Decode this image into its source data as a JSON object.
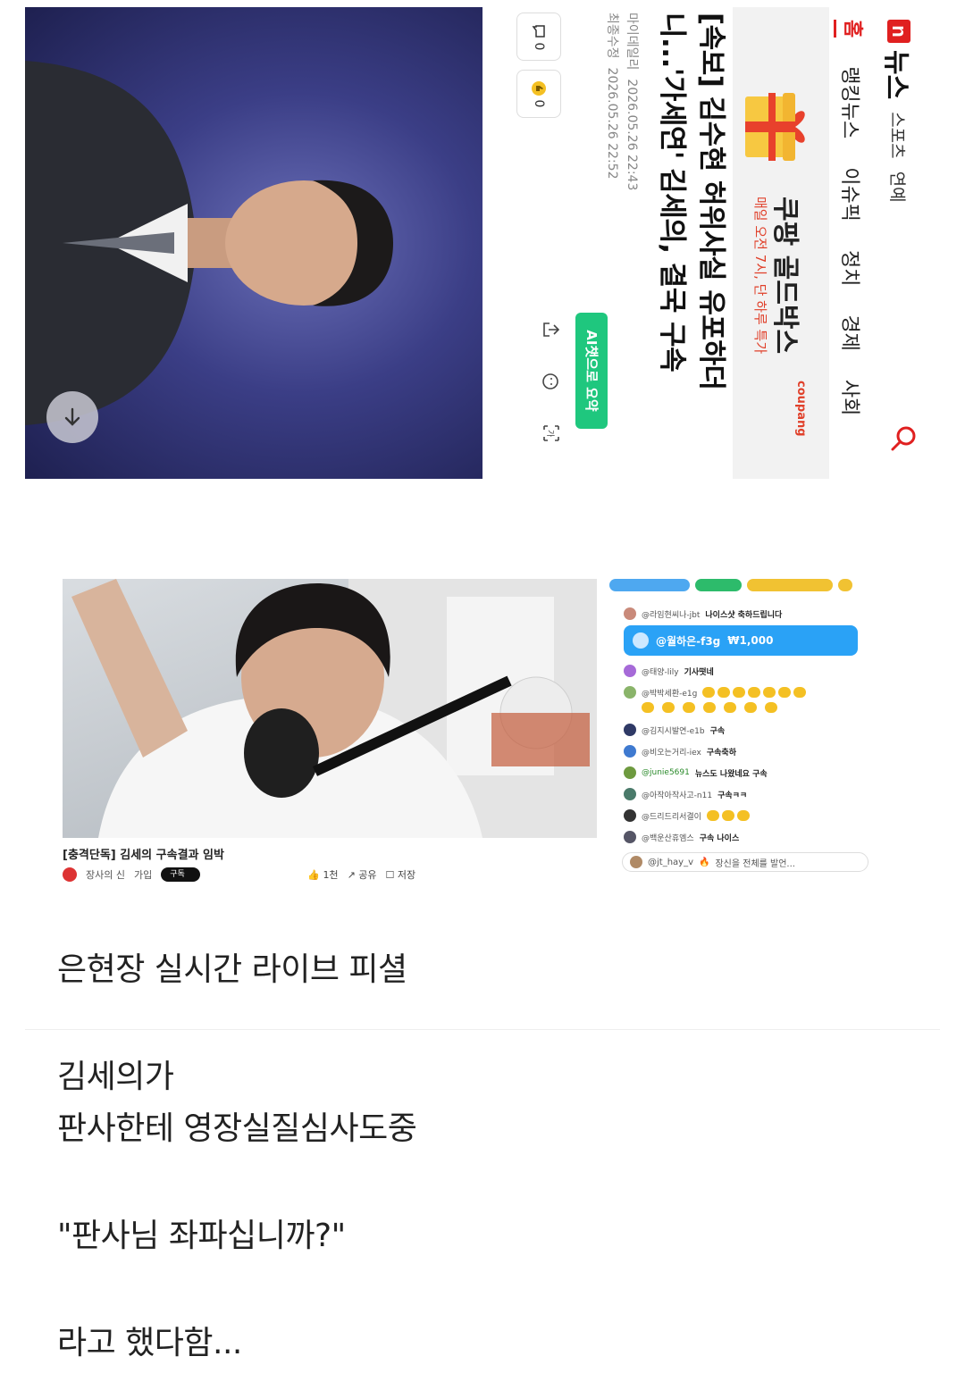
{
  "news": {
    "logo": "n",
    "title": "뉴스",
    "subtabs": [
      "스포츠",
      "연예"
    ],
    "tabs": [
      "홈",
      "랭킹뉴스",
      "이슈픽",
      "정치",
      "경제",
      "사회"
    ],
    "ad": {
      "title": "쿠팡 골드박스",
      "subtitle": "매일 오전 7시, 단 하루 특가",
      "brand": "coupang"
    },
    "headline": "[속보] 김수현 허위사실 유포하더니...'가세연' 김세의, 결국 구속",
    "publisher": "마이데일리",
    "input_date": "2026.05.26 22:43",
    "modified_label": "최종수정",
    "modified_date": "2026.05.26 22:52",
    "comments_count": "0",
    "reactions_count": "0",
    "summary_button": "AI챗으로 요약",
    "colors": {
      "brand_red": "#e02020",
      "summary_green": "#1fc77e"
    }
  },
  "stream": {
    "video_title": "[충격단독] 김세의 구속결과 임박",
    "channel": "장사의 신",
    "join_label": "가입",
    "subscribe_label": "구독",
    "like_count": "1천",
    "share_label": "공유",
    "save_label": "저장",
    "chat": {
      "donation_user": "@월하은-f3g",
      "donation_amount": "₩1,000",
      "messages": [
        {
          "user": "@라임현씨나-jbt",
          "text": "나이스샷 축하드립니다"
        },
        {
          "user": "@태양-lily",
          "text": "기사떳네"
        },
        {
          "user": "@박박세환-e1g",
          "text": ""
        },
        {
          "user": "@김지시발연-e1b",
          "text": "구속"
        },
        {
          "user": "@비오는거리-iex",
          "text": "구속축하"
        },
        {
          "user": "@junie5691",
          "text": "뉴스도 나왔네요 구속"
        },
        {
          "user": "@아작아작사고-n11",
          "text": "구속ㅋㅋ"
        },
        {
          "user": "@드리드리서결이",
          "text": ""
        },
        {
          "user": "@백운산휴엠스",
          "text": "구속 나이스"
        }
      ],
      "input_user": "@jt_hay_v",
      "input_text": "장신을 전체를 발언..."
    }
  },
  "post": {
    "line1": "은현장 실시간 라이브 피셜",
    "line2": "김세의가",
    "line3": "판사한테 영장실질심사도중",
    "line4": "\"판사님 좌파십니까?\"",
    "line5": "라고 했다함..."
  }
}
